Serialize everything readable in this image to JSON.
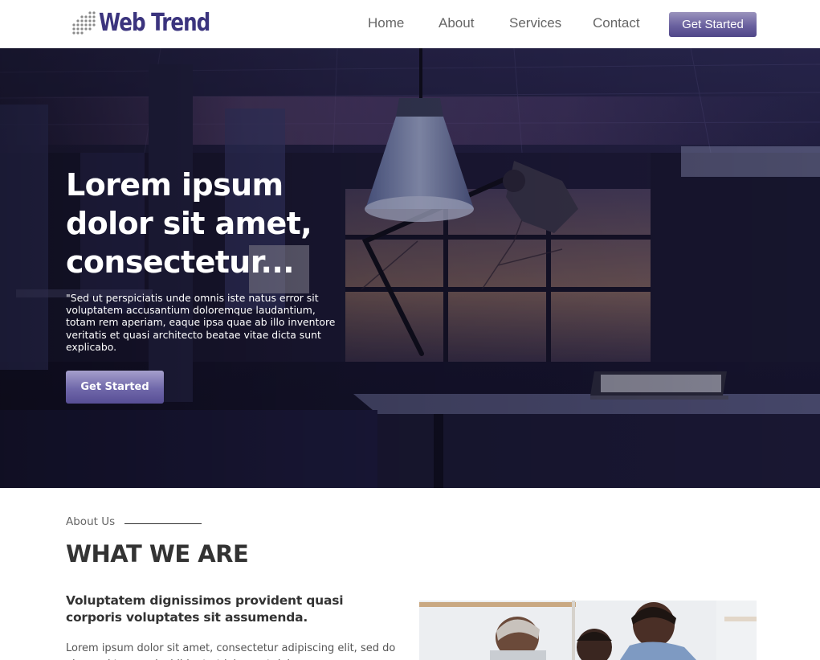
{
  "brand": {
    "name": "Web Trend",
    "color": "#3b347e"
  },
  "nav": {
    "items": [
      {
        "label": "Home"
      },
      {
        "label": "About"
      },
      {
        "label": "Services"
      },
      {
        "label": "Contact"
      }
    ],
    "cta_label": "Get Started"
  },
  "hero": {
    "title": "Lorem ipsum dolor sit amet, consectetur...",
    "text": "\"Sed ut perspiciatis unde omnis iste natus error sit voluptatem accusantium doloremque laudantium, totam rem aperiam, eaque ipsa quae ab illo inventore veritatis et quasi architecto beatae vitae dicta sunt explicabo.",
    "cta_label": "Get Started"
  },
  "about": {
    "eyebrow": "About Us",
    "heading": "WHAT WE ARE",
    "subheading": "Voluptatem dignissimos provident quasi corporis voluptates sit assumenda.",
    "body": "Lorem ipsum dolor sit amet, consectetur adipiscing elit, sed do eiusmod tempor incididunt ut labore et dolore"
  },
  "colors": {
    "accent": "#6a619f",
    "text_dark": "#333333",
    "nav_text": "#666666"
  }
}
